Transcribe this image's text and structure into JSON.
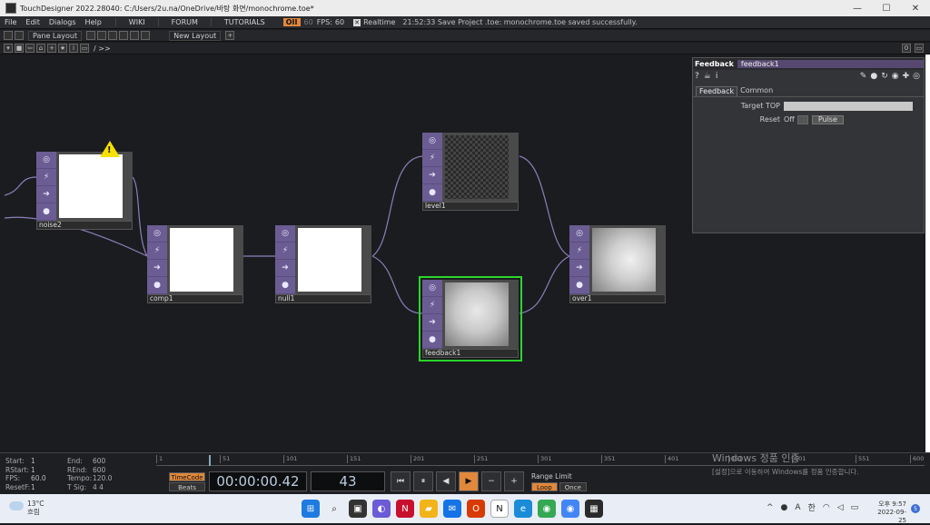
{
  "window": {
    "title": "TouchDesigner 2022.28040: C:/Users/2u.na/OneDrive/바탕 화면/monochrome.toe*",
    "min": "—",
    "max": "☐",
    "close": "✕"
  },
  "menubar": {
    "items": [
      "File",
      "Edit",
      "Dialogs",
      "Help"
    ],
    "links": [
      "WIKI",
      "FORUM",
      "TUTORIALS"
    ],
    "op_indicator": "OII",
    "fps_target": "60",
    "fps_label": "FPS:",
    "fps_value": "60",
    "realtime_check": "✕",
    "realtime_label": "Realtime",
    "status_message": "21:52:33 Save Project .toe: monochrome.toe saved successfully."
  },
  "panebar": {
    "pane_layout": "Pane Layout",
    "new_layout": "New Layout",
    "add": "+"
  },
  "pathbar": {
    "path": "/ >>"
  },
  "nodes": [
    {
      "id": "noise2",
      "label": "noise2",
      "image": "white",
      "warning": true
    },
    {
      "id": "comp1",
      "label": "comp1",
      "image": "white"
    },
    {
      "id": "null1",
      "label": "null1",
      "image": "white"
    },
    {
      "id": "level1",
      "label": "level1",
      "image": "checker"
    },
    {
      "id": "feedback1",
      "label": "feedback1",
      "image": "noise",
      "selected": true
    },
    {
      "id": "over1",
      "label": "over1",
      "image": "noise2"
    }
  ],
  "params": {
    "op_type": "Feedback",
    "op_name": "feedback1",
    "icons": [
      "?",
      "☕",
      "i"
    ],
    "tabs": [
      "Feedback",
      "Common"
    ],
    "target_top_label": "Target TOP",
    "reset_label": "Reset",
    "reset_value": "Off",
    "pulse_label": "Pulse"
  },
  "timeline": {
    "info": [
      {
        "k": "Start:",
        "v": "1",
        "k2": "End:",
        "v2": "600"
      },
      {
        "k": "RStart:",
        "v": "1",
        "k2": "REnd:",
        "v2": "600"
      },
      {
        "k": "FPS:",
        "v": "60.0",
        "k2": "Tempo:",
        "v2": "120.0"
      },
      {
        "k": "ResetF:",
        "v": "1",
        "k2": "T Sig:",
        "v2": "4    4"
      }
    ],
    "ruler": [
      "1",
      "51",
      "101",
      "151",
      "201",
      "251",
      "301",
      "351",
      "401",
      "451",
      "501",
      "551",
      "600"
    ],
    "timecode_label": "TimeCode",
    "beats_label": "Beats",
    "timecode_value": "00:00:00.42",
    "frame_value": "43",
    "range_limit_label": "Range Limit",
    "loop_label": "Loop",
    "once_label": "Once"
  },
  "watermark": {
    "line1": "Windows 정품 인증",
    "line2": "[설정]으로 이동하여 Windows를 정품 인증합니다."
  },
  "taskbar": {
    "temp": "13°C",
    "weather": "흐림",
    "ime": "A",
    "lang": "한",
    "time": "오후 9:57",
    "date": "2022-09-25",
    "notif_count": "5"
  }
}
